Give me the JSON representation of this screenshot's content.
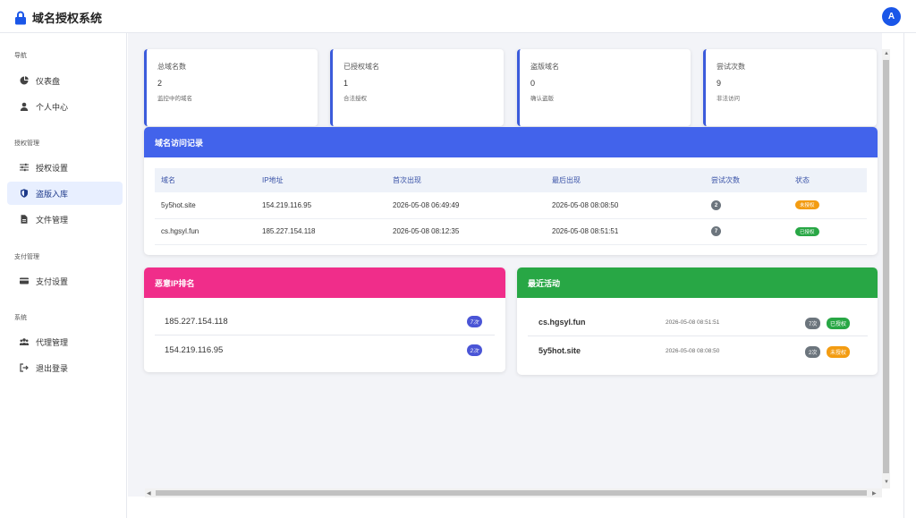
{
  "app": {
    "title": "域名授权系统",
    "avatar": "A"
  },
  "sidebar": {
    "sections": [
      {
        "title": "导航"
      },
      {
        "title": "授权管理"
      },
      {
        "title": "支付管理"
      },
      {
        "title": "系统"
      }
    ],
    "items": [
      {
        "label": "仪表盘",
        "icon": "pie-chart-icon"
      },
      {
        "label": "个人中心",
        "icon": "user-icon"
      },
      {
        "label": "授权设置",
        "icon": "sliders-icon"
      },
      {
        "label": "盗版入库",
        "icon": "shield-icon",
        "active": true
      },
      {
        "label": "文件管理",
        "icon": "file-icon"
      },
      {
        "label": "支付设置",
        "icon": "credit-card-icon"
      },
      {
        "label": "代理管理",
        "icon": "users-icon"
      },
      {
        "label": "退出登录",
        "icon": "logout-icon"
      }
    ]
  },
  "stats": [
    {
      "label": "总域名数",
      "value": "2",
      "desc": "监控中的域名"
    },
    {
      "label": "已授权域名",
      "value": "1",
      "desc": "合法授权"
    },
    {
      "label": "盗版域名",
      "value": "0",
      "desc": "确认盗版"
    },
    {
      "label": "尝试次数",
      "value": "9",
      "desc": "非法访问"
    }
  ],
  "records": {
    "title": "域名访问记录",
    "columns": [
      "域名",
      "IP地址",
      "首次出现",
      "最后出现",
      "尝试次数",
      "状态"
    ],
    "rows": [
      {
        "domain": "5y5hot.site",
        "ip": "154.219.116.95",
        "first": "2026-05-08 06:49:49",
        "last": "2026-05-08 08:08:50",
        "count": "2",
        "status": "未授权"
      },
      {
        "domain": "cs.hgsyl.fun",
        "ip": "185.227.154.118",
        "first": "2026-05-08 08:12:35",
        "last": "2026-05-08 08:51:51",
        "count": "7",
        "status": "已授权"
      }
    ]
  },
  "ip_rank": {
    "title": "恶意IP排名",
    "rows": [
      {
        "ip": "185.227.154.118",
        "count": "7次"
      },
      {
        "ip": "154.219.116.95",
        "count": "2次"
      }
    ]
  },
  "recent": {
    "title": "最近活动",
    "rows": [
      {
        "domain": "cs.hgsyl.fun",
        "time": "2026-05-08 08:51:51",
        "count": "7次",
        "status": "已授权"
      },
      {
        "domain": "5y5hot.site",
        "time": "2026-05-08 08:08:50",
        "count": "2次",
        "status": "未授权"
      }
    ]
  },
  "colors": {
    "brand": "#1a56e8",
    "records_header": "#4263eb",
    "ip_header": "#f02d8a",
    "recent_header": "#28a745",
    "unauthorized": "#f39c12",
    "authorized": "#28a745"
  }
}
